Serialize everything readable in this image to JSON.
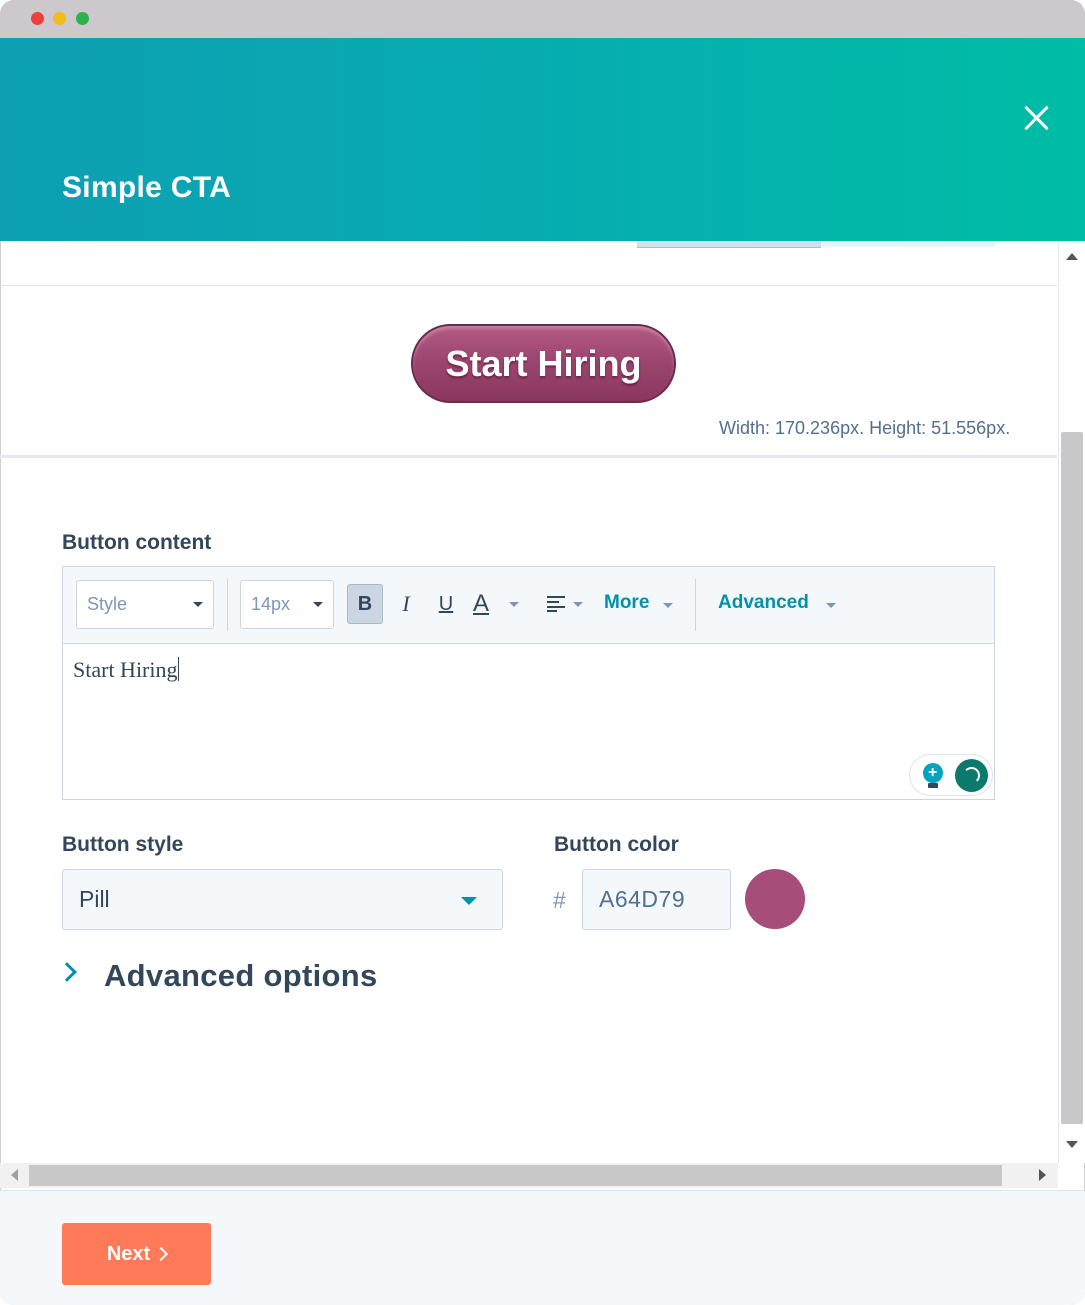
{
  "window": {
    "traffic_lights": [
      "close",
      "minimize",
      "maximize"
    ]
  },
  "header": {
    "title": "Simple CTA",
    "close_icon": "close-icon"
  },
  "preview": {
    "button_text": "Start Hiring",
    "size_text": "Width: 170.236px. Height: 51.556px."
  },
  "button_content": {
    "label": "Button content",
    "toolbar": {
      "style_value": "Style",
      "font_size_value": "14px",
      "bold_label": "B",
      "italic_label": "I",
      "underline_label": "U",
      "text_color_label": "A",
      "more_label": "More",
      "advanced_label": "Advanced"
    },
    "text": "Start Hiring"
  },
  "button_style": {
    "label": "Button style",
    "value": "Pill"
  },
  "button_color": {
    "label": "Button color",
    "hash": "#",
    "value": "A64D79",
    "swatch_color": "#a64d79"
  },
  "advanced_options": {
    "label": "Advanced options"
  },
  "footer": {
    "next_label": "Next"
  },
  "colors": {
    "header_gradient_start": "#0e9fb3",
    "header_gradient_end": "#00bda5",
    "link": "#0091ae",
    "next_button": "#ff7a59"
  }
}
